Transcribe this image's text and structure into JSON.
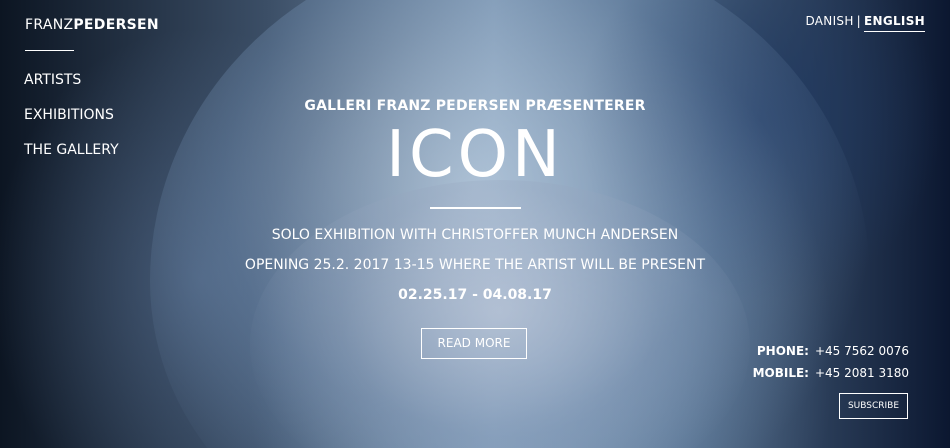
{
  "brand": {
    "logo_light": "FRANZ",
    "logo_bold": "PEDERSEN"
  },
  "nav": {
    "items": [
      {
        "label": "ARTISTS"
      },
      {
        "label": "EXHIBITIONS"
      },
      {
        "label": "THE GALLERY"
      }
    ]
  },
  "language": {
    "danish": "DANISH",
    "separator": "|",
    "english": "ENGLISH",
    "active": "ENGLISH"
  },
  "hero": {
    "presents": "GALLERI FRANZ PEDERSEN PRÆSENTERER",
    "title": "ICON",
    "subtitle": "SOLO EXHIBITION WITH CHRISTOFFER MUNCH ANDERSEN",
    "opening": "OPENING 25.2. 2017 13-15 WHERE THE ARTIST WILL BE PRESENT",
    "dates": "02.25.17 - 04.08.17",
    "cta_label": "READ MORE"
  },
  "contact": {
    "phone_label": "PHONE:",
    "phone": "+45 7562 0076",
    "mobile_label": "MOBILE:",
    "mobile": "+45 2081 3180",
    "subscribe_label": "SUBSCRIBE"
  }
}
